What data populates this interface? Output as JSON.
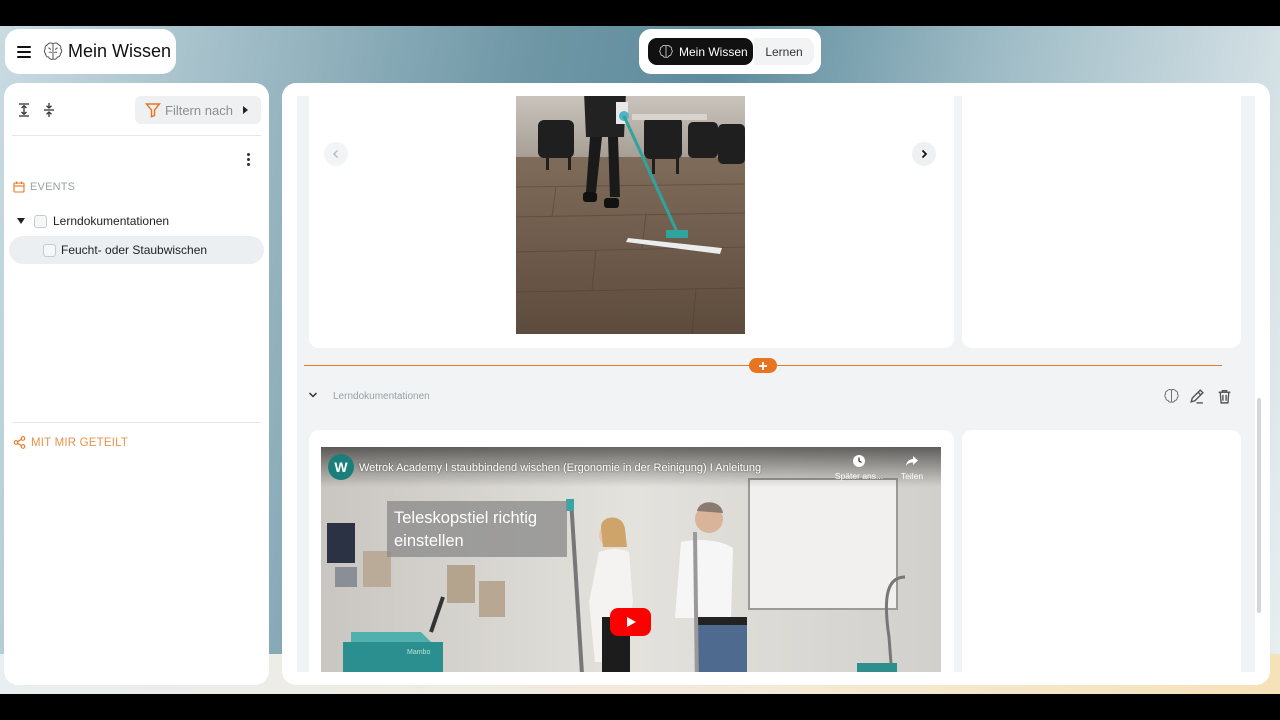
{
  "app": {
    "title": "Mein Wissen"
  },
  "mode_toggle": {
    "active_label": "Mein Wissen",
    "inactive_label": "Lernen"
  },
  "sidebar": {
    "filter_label": "Filtern nach",
    "events_heading": "EVENTS",
    "tree": [
      {
        "label": "Lerndokumentationen",
        "expanded": true
      },
      {
        "label": "Feucht- oder Staubwischen",
        "selected": true
      }
    ],
    "shared_heading": "MIT MIR GETEILT"
  },
  "main": {
    "group_label": "Lerndokumentationen",
    "video": {
      "channel_badge": "W",
      "title": "Wetrok Academy I staubbindend wischen (Ergonomie in der Reinigung) I Anleitung",
      "watch_later_label": "Später ans...",
      "share_label": "Teilen",
      "caption": "Teleskopstiel richtig einstellen",
      "machine_label": "Mambo"
    }
  },
  "colors": {
    "accent_orange": "#e87422",
    "active_toggle": "#111111",
    "youtube_red": "#ff0000"
  },
  "icons": {
    "menu": "hamburger-icon",
    "logo": "brain-icon",
    "expand_all": "expand-all-icon",
    "collapse_all": "collapse-all-icon",
    "filter": "funnel-icon",
    "events": "calendar-icon",
    "shared": "share-icon",
    "learn": "brain-icon",
    "edit": "pencil-icon",
    "delete": "trash-icon",
    "add": "plus-icon"
  }
}
